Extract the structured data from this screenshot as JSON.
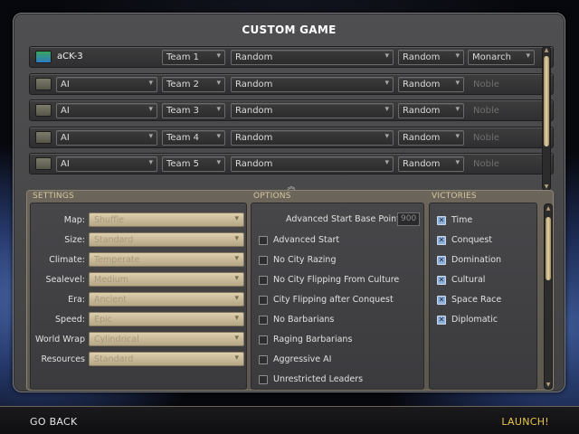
{
  "title": "CUSTOM GAME",
  "players": [
    {
      "name": "aCK-3",
      "human": true,
      "team": "Team 1",
      "civ": "Random",
      "leader": "Random",
      "difficulty": "Monarch"
    },
    {
      "name": "AI",
      "human": false,
      "team": "Team 2",
      "civ": "Random",
      "leader": "Random",
      "difficulty": "Noble"
    },
    {
      "name": "AI",
      "human": false,
      "team": "Team 3",
      "civ": "Random",
      "leader": "Random",
      "difficulty": "Noble"
    },
    {
      "name": "AI",
      "human": false,
      "team": "Team 4",
      "civ": "Random",
      "leader": "Random",
      "difficulty": "Noble"
    },
    {
      "name": "AI",
      "human": false,
      "team": "Team 5",
      "civ": "Random",
      "leader": "Random",
      "difficulty": "Noble"
    }
  ],
  "collapse_icon": "chevron-up-icon",
  "settings": {
    "header": "SETTINGS",
    "items": [
      {
        "label": "Map:",
        "value": "Shuffle"
      },
      {
        "label": "Size:",
        "value": "Standard"
      },
      {
        "label": "Climate:",
        "value": "Temperate"
      },
      {
        "label": "Sealevel:",
        "value": "Medium"
      },
      {
        "label": "Era:",
        "value": "Ancient"
      },
      {
        "label": "Speed:",
        "value": "Epic"
      },
      {
        "label": "World Wrap",
        "value": "Cylindrical"
      },
      {
        "label": "Resources",
        "value": "Standard"
      }
    ]
  },
  "options": {
    "header": "OPTIONS",
    "advanced_start_label": "Advanced Start Base Points:",
    "advanced_start_value": "900",
    "items": [
      {
        "label": "Advanced Start",
        "checked": false
      },
      {
        "label": "No City Razing",
        "checked": false
      },
      {
        "label": "No City Flipping From Culture",
        "checked": false
      },
      {
        "label": "City Flipping after Conquest",
        "checked": false
      },
      {
        "label": "No Barbarians",
        "checked": false
      },
      {
        "label": "Raging Barbarians",
        "checked": false
      },
      {
        "label": "Aggressive AI",
        "checked": false
      },
      {
        "label": "Unrestricted Leaders",
        "checked": false
      }
    ]
  },
  "victories": {
    "header": "VICTORIES",
    "items": [
      {
        "label": "Time",
        "checked": true
      },
      {
        "label": "Conquest",
        "checked": true
      },
      {
        "label": "Domination",
        "checked": true
      },
      {
        "label": "Cultural",
        "checked": true
      },
      {
        "label": "Space Race",
        "checked": true
      },
      {
        "label": "Diplomatic",
        "checked": true
      }
    ]
  },
  "footer": {
    "back_label": "GO BACK",
    "launch_label": "LAUNCH!",
    "launch_color": "#e8c64a"
  },
  "check_mark": "✕",
  "dropdown_arrow": "⌄"
}
